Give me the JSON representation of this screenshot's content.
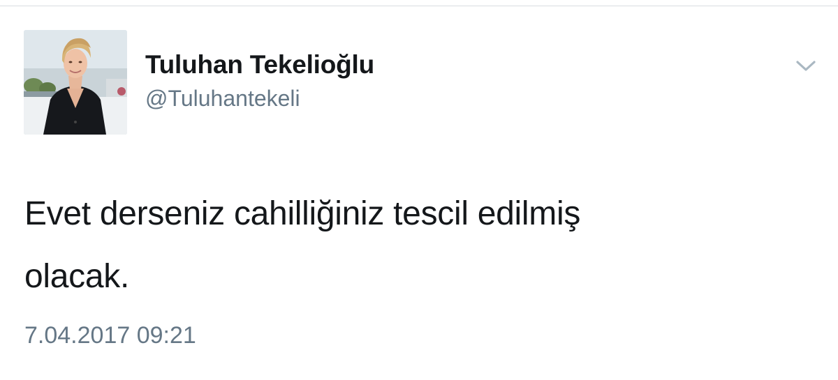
{
  "user": {
    "display_name": "Tuluhan Tekelioğlu",
    "handle": "@Tuluhantekeli",
    "avatar_icon": "profile-photo"
  },
  "header": {
    "menu_icon": "chevron-down-icon"
  },
  "tweet": {
    "text_lines": [
      "Evet derseniz cahilliğiniz tescil edilmiş",
      "olacak."
    ],
    "timestamp": "7.04.2017 09:21"
  },
  "colors": {
    "primary_text": "#14171a",
    "secondary_text": "#657786",
    "chevron": "#aab8c2",
    "divider": "#d9dde1"
  }
}
